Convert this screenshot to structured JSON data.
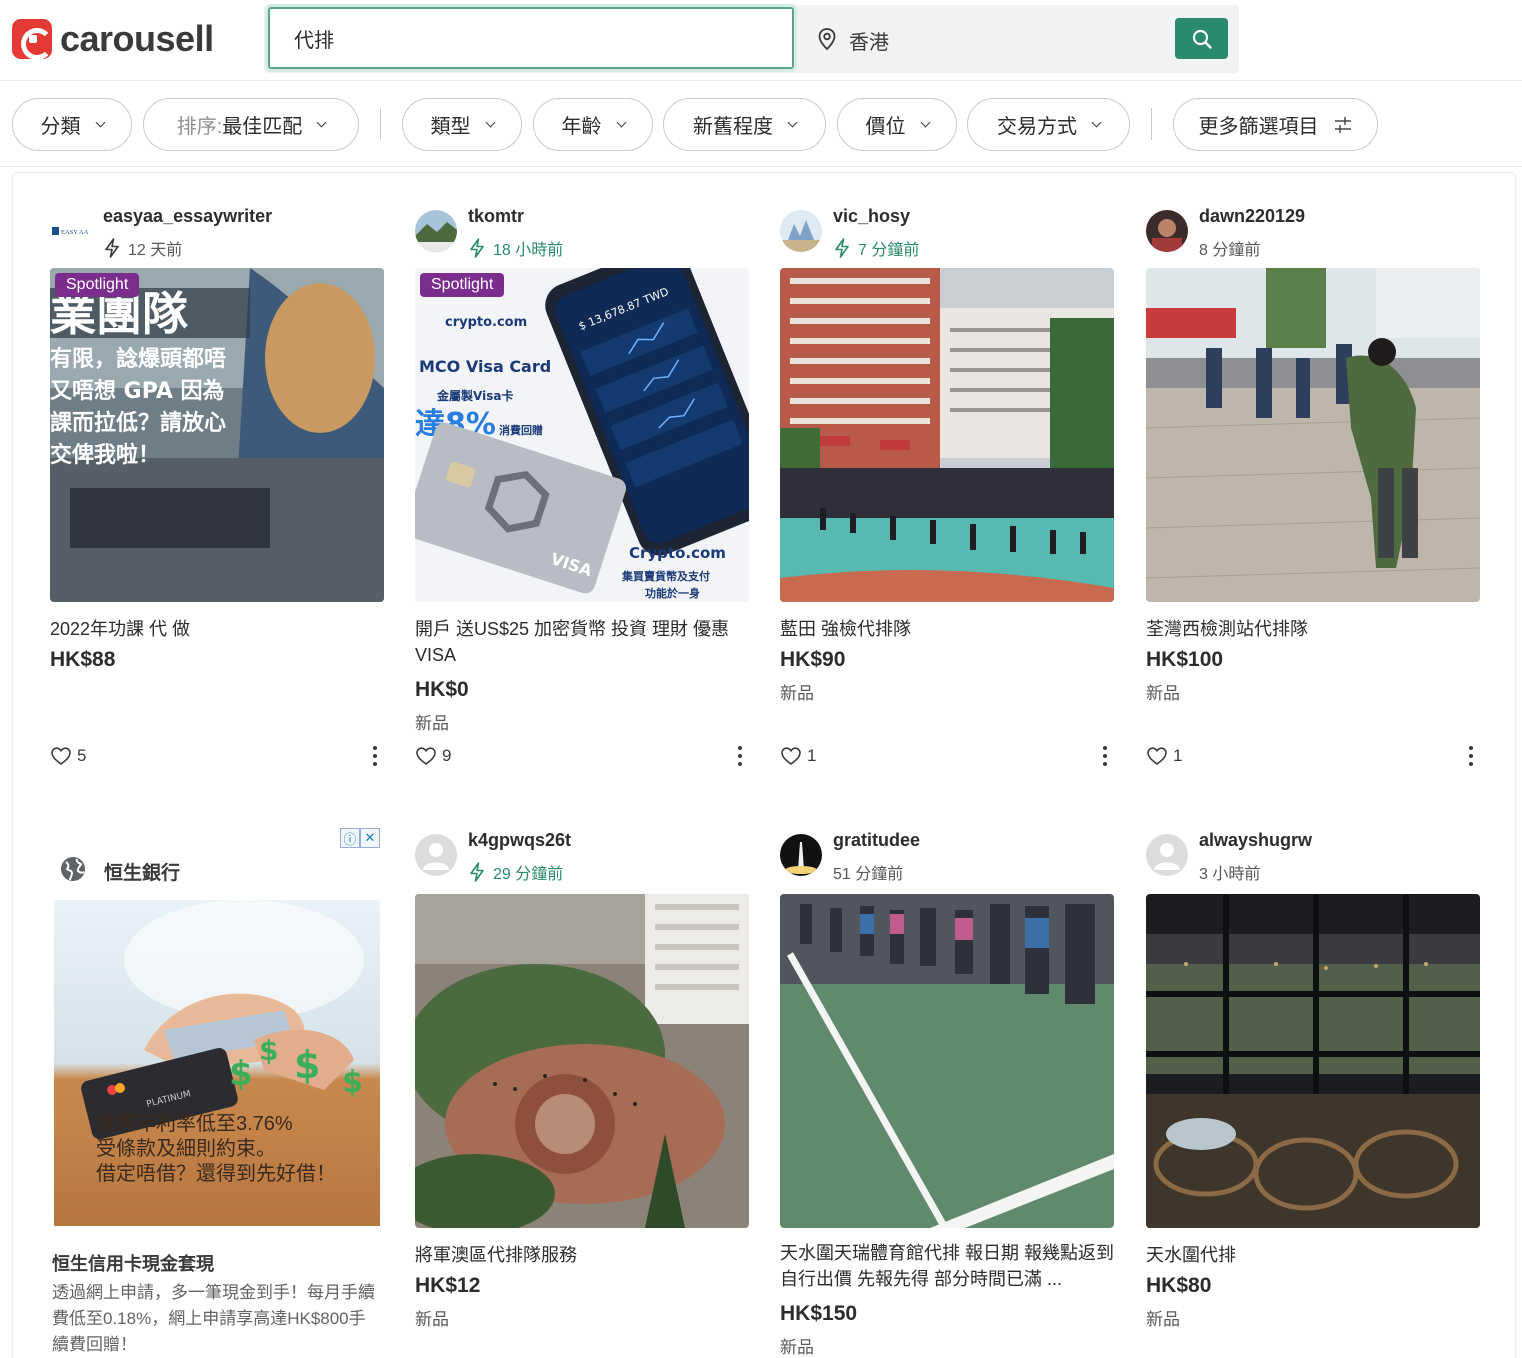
{
  "brand": {
    "name": "carousell",
    "color": "#e53935",
    "accent": "#2a8a6d"
  },
  "search": {
    "query": "代排",
    "location": "香港"
  },
  "filters": {
    "category": "分類",
    "sort_prefix": "排序:",
    "sort_value": "最佳匹配",
    "type": "類型",
    "age": "年齡",
    "condition": "新舊程度",
    "price": "價位",
    "deal": "交易方式",
    "more": "更多篩選項目"
  },
  "spotlight_label": "Spotlight",
  "listings": [
    {
      "seller": "easyaa_essaywriter",
      "time": "12 天前",
      "boosted": true,
      "spotlight": true,
      "title": "2022年功課 代 做",
      "price": "HK$88",
      "condition": "",
      "likes": "5"
    },
    {
      "seller": "tkomtr",
      "time": "18 小時前",
      "boosted": true,
      "spotlight": true,
      "title": "開戶 送US$25 加密貨幣 投資 理財 優惠 VISA",
      "price": "HK$0",
      "condition": "新品",
      "likes": "9"
    },
    {
      "seller": "vic_hosy",
      "time": "7 分鐘前",
      "boosted": true,
      "spotlight": false,
      "title": "藍田 強檢代排隊",
      "price": "HK$90",
      "condition": "新品",
      "likes": "1"
    },
    {
      "seller": "dawn220129",
      "time": "8 分鐘前",
      "boosted": false,
      "spotlight": false,
      "title": "荃灣西檢測站代排隊",
      "price": "HK$100",
      "condition": "新品",
      "likes": "1"
    },
    {
      "seller": "k4gpwqs26t",
      "time": "29 分鐘前",
      "boosted": true,
      "spotlight": false,
      "title": "將軍澳區代排隊服務",
      "price": "HK$12",
      "condition": "新品",
      "likes": ""
    },
    {
      "seller": "gratitudee",
      "time": "51 分鐘前",
      "boosted": false,
      "spotlight": false,
      "title": "天水圍天瑞體育館代排 報日期 報幾點返到 自行出價 先報先得 部分時間已滿 ...",
      "price": "HK$150",
      "condition": "新品",
      "likes": ""
    },
    {
      "seller": "alwayshugrw",
      "time": "3 小時前",
      "boosted": false,
      "spotlight": false,
      "title": "天水圍代排",
      "price": "HK$80",
      "condition": "新品",
      "likes": ""
    }
  ],
  "ad": {
    "advertiser": "恒生銀行",
    "image_text_line1": "實際年利率低至3.76%",
    "image_text_line2": "受條款及細則約束。",
    "image_text_line3": "借定唔借？還得到先好借！",
    "title": "恒生信用卡現金套現",
    "description": "透過網上申請，多一筆現金到手！每月手續費低至0.18%，網上申請享高達HK$800手續費回贈！"
  }
}
